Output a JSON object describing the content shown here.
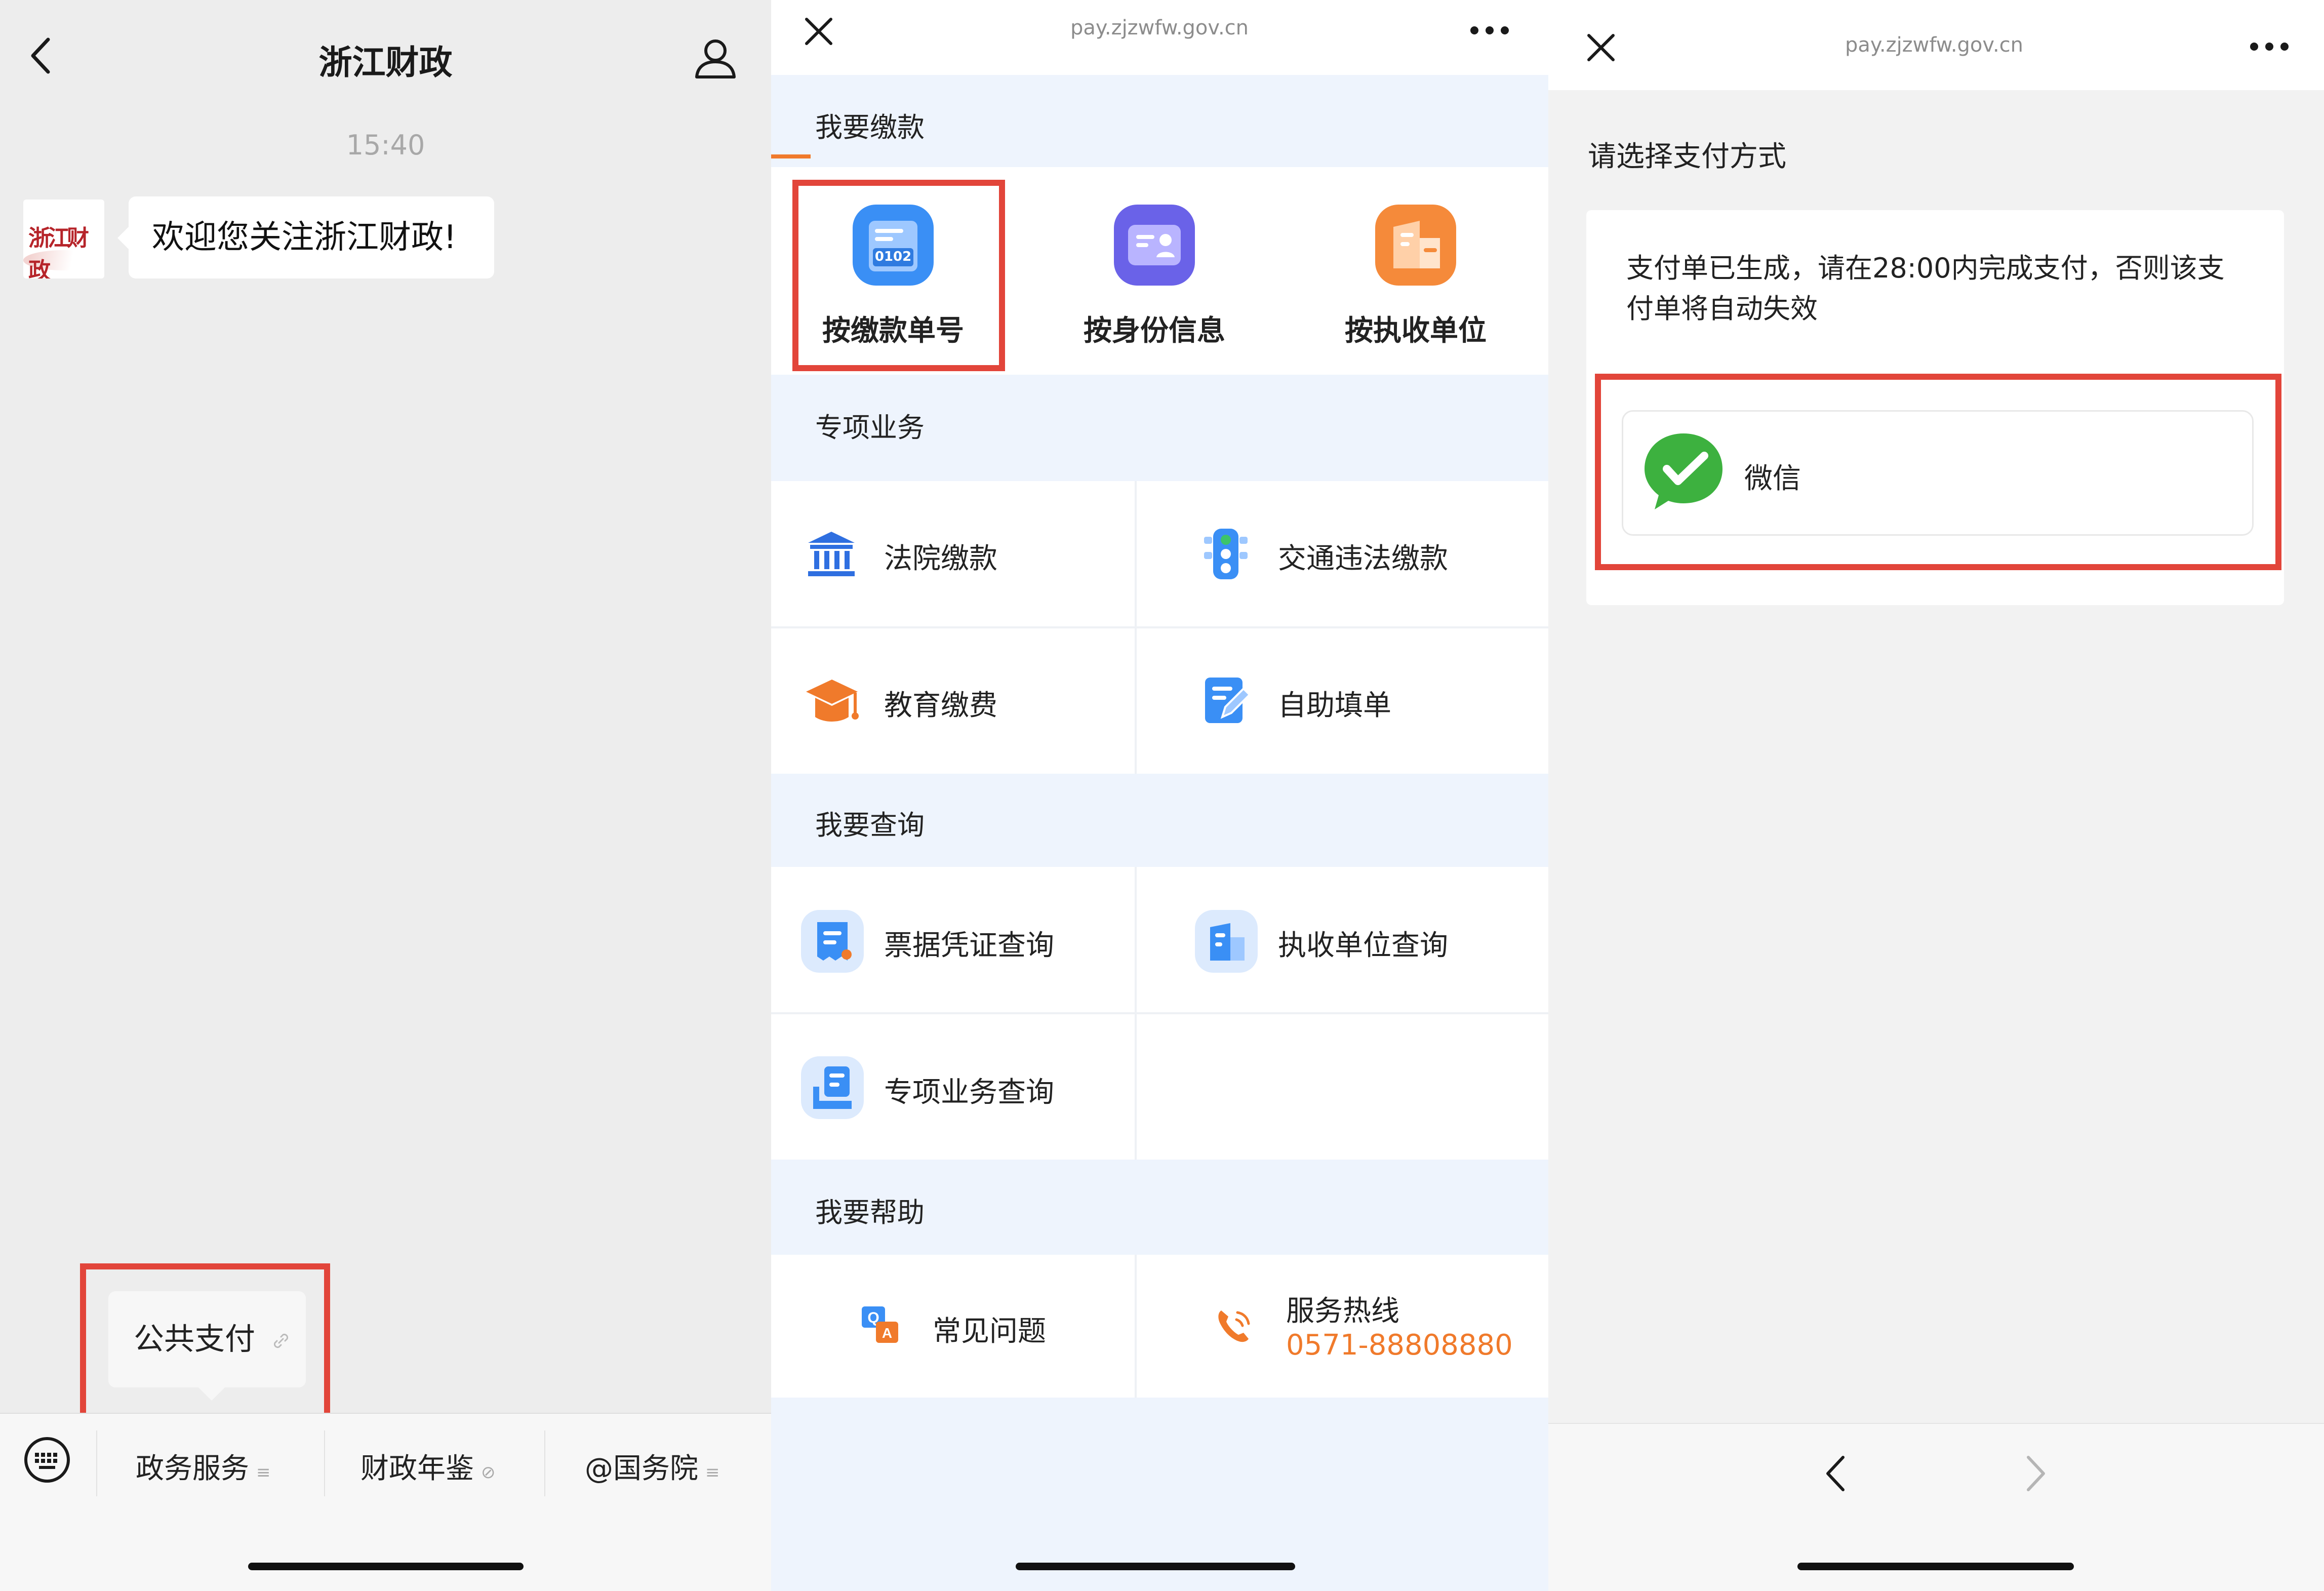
{
  "panel1": {
    "title": "浙江财政",
    "timestamp": "15:40",
    "avatar_text": "浙江财政",
    "message": "欢迎您关注浙江财政!",
    "popup_item": "公共支付",
    "menu": [
      {
        "label": "政务服务"
      },
      {
        "label": "财政年鉴"
      },
      {
        "label": "@国务院"
      }
    ]
  },
  "panel2": {
    "url": "pay.zjzwfw.gov.cn",
    "section_pay": "我要缴款",
    "pay_options": [
      {
        "label": "按缴款单号",
        "icon_text": "0102",
        "color": "#3a8ff5"
      },
      {
        "label": "按身份信息",
        "color": "#6a62e8"
      },
      {
        "label": "按执收单位",
        "color": "#f58a3a"
      }
    ],
    "section_special": "专项业务",
    "special_items": [
      "法院缴款",
      "交通违法缴款",
      "教育缴费",
      "自助填单"
    ],
    "section_query": "我要查询",
    "query_items": [
      "票据凭证查询",
      "执收单位查询",
      "专项业务查询"
    ],
    "section_help": "我要帮助",
    "help_items": {
      "faq": "常见问题",
      "hotline_label": "服务热线",
      "hotline_number": "0571-88808880"
    },
    "accent_color": "#f07a2b"
  },
  "panel3": {
    "url": "pay.zjzwfw.gov.cn",
    "heading": "请选择支付方式",
    "notice": "支付单已生成，请在28:00内完成支付，否则该支付单将自动失效",
    "method": "微信",
    "wechat_color": "#3db13f"
  },
  "highlight_color": "#e2453a"
}
